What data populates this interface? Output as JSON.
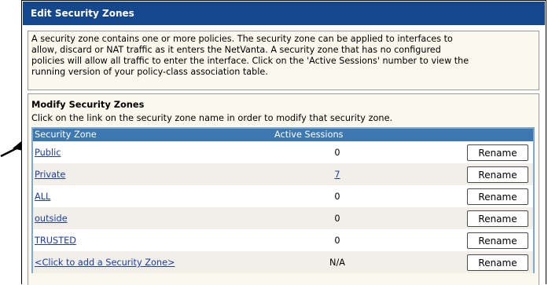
{
  "window": {
    "title": "Edit Security Zones"
  },
  "intro": {
    "lines": [
      "A security zone contains one or more policies. The security zone can be applied to interfaces to",
      "allow, discard or NAT traffic as it enters the NetVanta. A security zone that has no configured",
      "policies will allow all traffic to enter the interface. Click on the 'Active Sessions' number to view the",
      "running version of your policy-class association table."
    ]
  },
  "modify": {
    "heading": "Modify Security Zones",
    "instruction": "Click on the link on the security zone name in order to modify that security zone.",
    "columns": {
      "zone": "Security Zone",
      "sessions": "Active Sessions"
    },
    "rows": [
      {
        "zone": "Public",
        "sessions": "0",
        "sessions_link": false,
        "button": "Rename"
      },
      {
        "zone": "Private",
        "sessions": "7",
        "sessions_link": true,
        "button": "Rename"
      },
      {
        "zone": "ALL",
        "sessions": "0",
        "sessions_link": false,
        "button": "Rename"
      },
      {
        "zone": "outside",
        "sessions": "0",
        "sessions_link": false,
        "button": "Rename"
      },
      {
        "zone": "TRUSTED",
        "sessions": "0",
        "sessions_link": false,
        "button": "Rename"
      },
      {
        "zone": "<Click to add a Security Zone>",
        "sessions": "N/A",
        "sessions_link": false,
        "button": "Rename"
      }
    ]
  },
  "colors": {
    "title_bar": "#14478c",
    "table_header": "#3d78b0",
    "link": "#1c3da6",
    "panel_background": "#fbf8ee"
  },
  "icons": {
    "pointer": "arrow-right-icon"
  }
}
